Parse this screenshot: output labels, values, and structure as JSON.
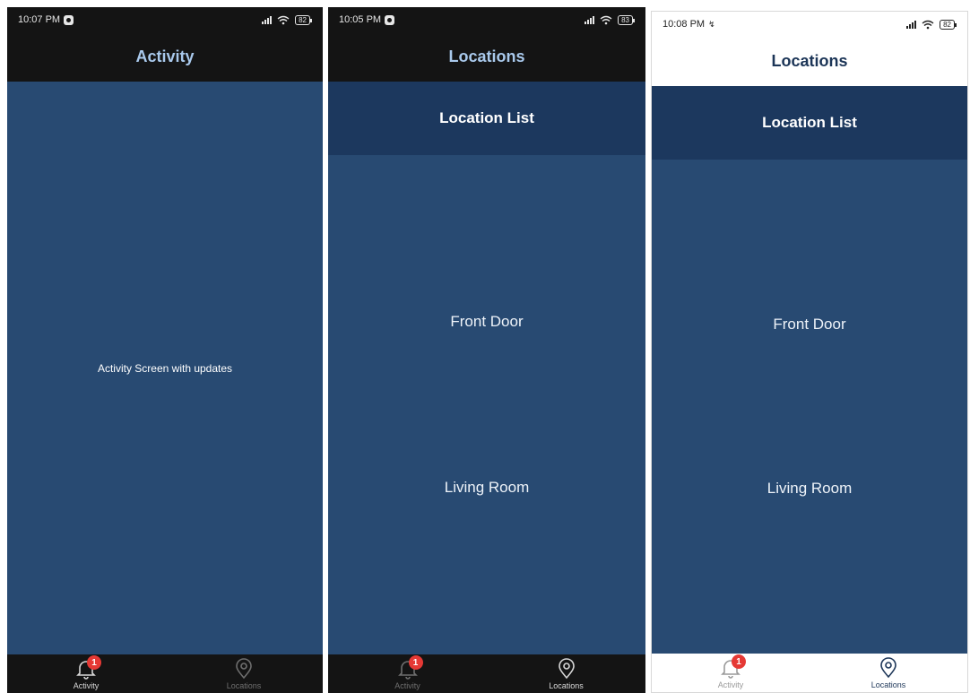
{
  "phones": [
    {
      "theme": "dark",
      "status": {
        "time": "10:07 PM",
        "battery": "82"
      },
      "title": "Activity",
      "body_text": "Activity Screen with updates",
      "tabs": [
        {
          "label": "Activity",
          "icon": "bell-icon",
          "badge": "1",
          "active": true
        },
        {
          "label": "Locations",
          "icon": "location-pin-icon",
          "active": false
        }
      ]
    },
    {
      "theme": "dark",
      "status": {
        "time": "10:05 PM",
        "battery": "83"
      },
      "title": "Locations",
      "list_header": "Location List",
      "locations": [
        "Front Door",
        "Living Room"
      ],
      "tabs": [
        {
          "label": "Activity",
          "icon": "bell-icon",
          "badge": "1",
          "active": false
        },
        {
          "label": "Locations",
          "icon": "location-pin-icon",
          "active": true
        }
      ]
    },
    {
      "theme": "light",
      "status": {
        "time": "10:08 PM",
        "battery": "82"
      },
      "title": "Locations",
      "list_header": "Location List",
      "locations": [
        "Front Door",
        "Living Room"
      ],
      "tabs": [
        {
          "label": "Activity",
          "icon": "bell-icon",
          "badge": "1",
          "active": false
        },
        {
          "label": "Locations",
          "icon": "location-pin-icon",
          "active": true
        }
      ]
    }
  ],
  "colors": {
    "content_bg": "#284a72",
    "list_header_bg": "#1c385e",
    "dark_bar": "#141414",
    "badge": "#e53935"
  }
}
